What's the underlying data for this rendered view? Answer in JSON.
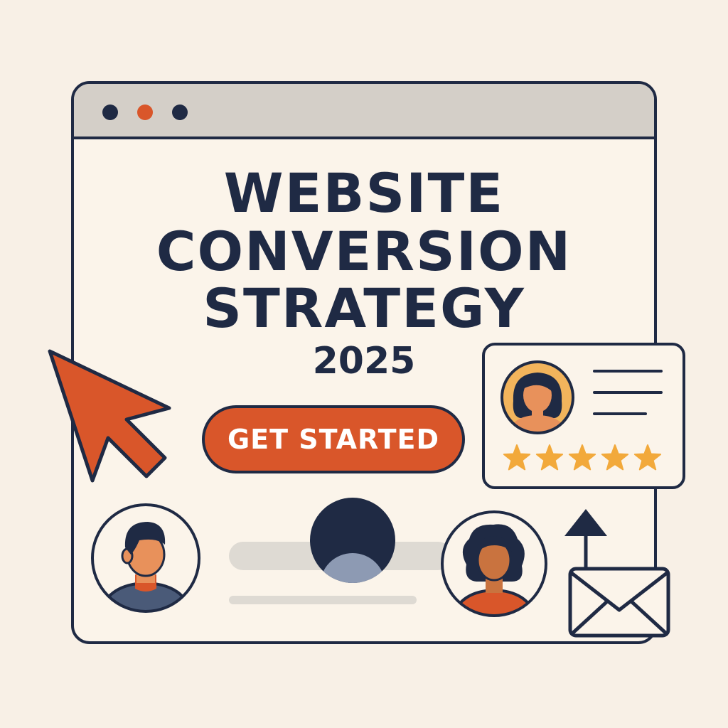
{
  "hero": {
    "title_lines": [
      "WEBSITE",
      "CONVERSION",
      "STRATEGY"
    ],
    "year": "2025"
  },
  "cta": {
    "label": "GET STARTED"
  },
  "review": {
    "rating": 5,
    "max_rating": 5
  },
  "colors": {
    "background": "#f8f0e6",
    "ink": "#1f2a44",
    "accent": "#d9562a",
    "star": "#f2a93b",
    "skin": "#e8915b"
  },
  "icons": [
    "cursor-arrow-icon",
    "avatar-man-icon",
    "avatar-woman-icon",
    "envelope-icon",
    "arrow-up-icon",
    "star-icon"
  ]
}
